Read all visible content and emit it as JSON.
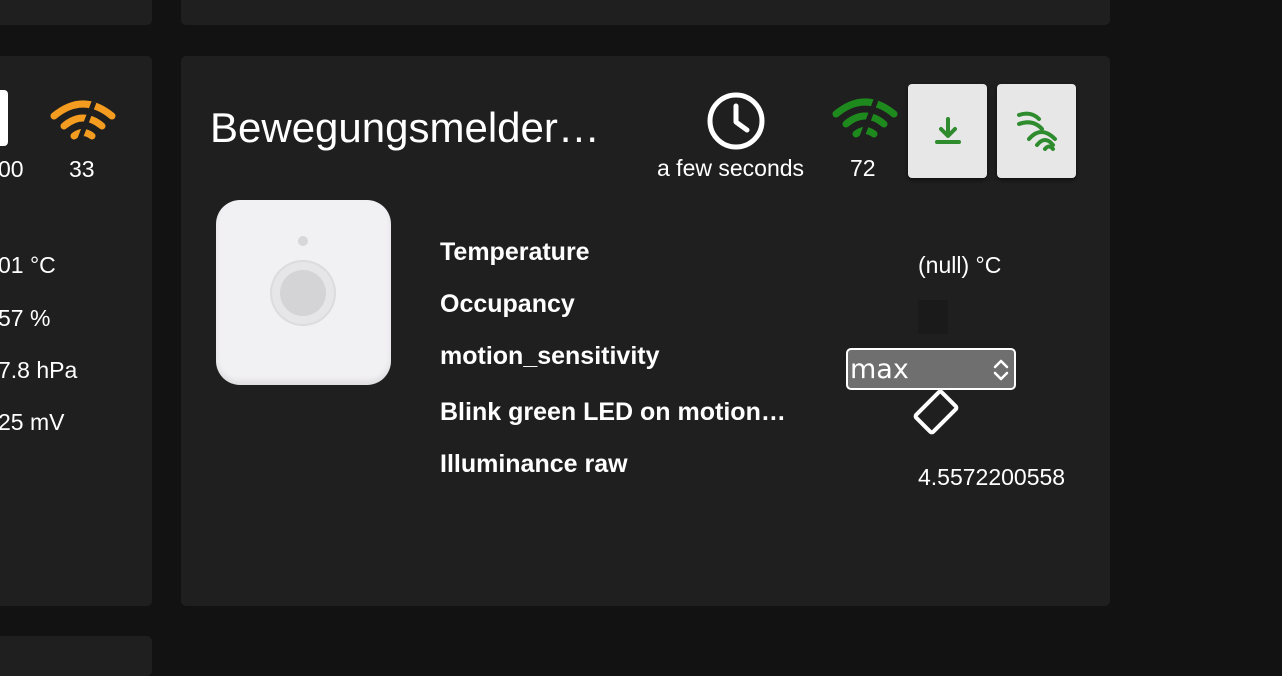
{
  "left_card": {
    "rssi": "33",
    "battery_partial": "00",
    "values": [
      "01 °C",
      "57 %",
      "7.8 hPa",
      "25 mV"
    ]
  },
  "device": {
    "title": "Bewegungsmelder…",
    "last_seen": "a few seconds",
    "rssi": "72",
    "properties": [
      {
        "label": "Temperature",
        "value": "(null) °C"
      },
      {
        "label": "Occupancy",
        "value": ""
      },
      {
        "label": "motion_sensitivity",
        "value": "max"
      },
      {
        "label": "Blink green LED on motion…",
        "value": ""
      },
      {
        "label": "Illuminance raw",
        "value": "4.5572200558"
      }
    ]
  },
  "colors": {
    "background": "#121212",
    "card": "#1f1f1f",
    "signal_good": "#1e8a1e",
    "signal_medium": "#f39c1f",
    "button_bg": "#e7e7e7"
  },
  "icons": {
    "battery": "battery-icon",
    "clock": "clock-icon",
    "signal": "wifi-signal-icon",
    "download": "download-icon",
    "ota": "ota-signal-icon"
  }
}
